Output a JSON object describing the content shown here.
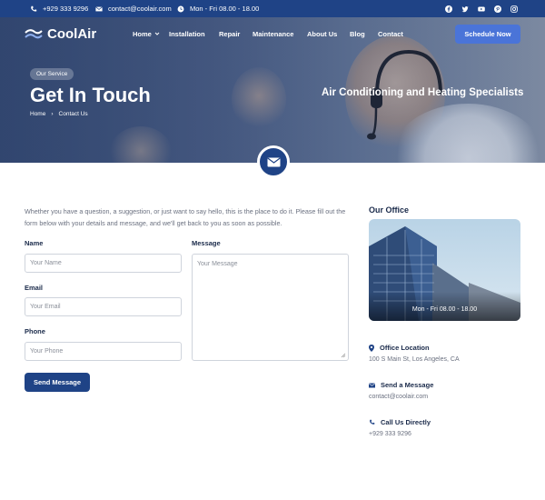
{
  "topbar": {
    "phone": "+929 333 9296",
    "email": "contact@coolair.com",
    "hours": "Mon - Fri 08.00 - 18.00",
    "social_icons": [
      "facebook-icon",
      "twitter-icon",
      "youtube-icon",
      "pinterest-icon",
      "instagram-icon"
    ]
  },
  "brand": {
    "name": "CoolAir"
  },
  "nav": {
    "items": [
      "Home",
      "Installation",
      "Repair",
      "Maintenance",
      "About Us",
      "Blog",
      "Contact"
    ],
    "cta": "Schedule Now"
  },
  "hero": {
    "badge": "Our Service",
    "title": "Get In Touch",
    "breadcrumb": [
      "Home",
      "Contact Us"
    ],
    "tagline": "Air Conditioning and Heating Specialists"
  },
  "form": {
    "intro": "Whether you have a question, a suggestion, or just want to say hello, this is the place to do it. Please fill out the form below with your details and message, and we'll get back to you as soon as possible.",
    "name_label": "Name",
    "name_placeholder": "Your Name",
    "email_label": "Email",
    "email_placeholder": "Your Email",
    "phone_label": "Phone",
    "phone_placeholder": "Your Phone",
    "message_label": "Message",
    "message_placeholder": "Your Message",
    "submit": "Send Message"
  },
  "office": {
    "title": "Our Office",
    "hours": "Mon - Fri 08.00 - 18.00",
    "location_title": "Office Location",
    "location": "100 S Main St, Los Angeles, CA",
    "message_title": "Send a Message",
    "message_email": "contact@coolair.com",
    "call_title": "Call Us Directly",
    "call_phone": "+929 333 9296"
  },
  "colors": {
    "primary": "#1f4386",
    "accent": "#4a74d8"
  }
}
